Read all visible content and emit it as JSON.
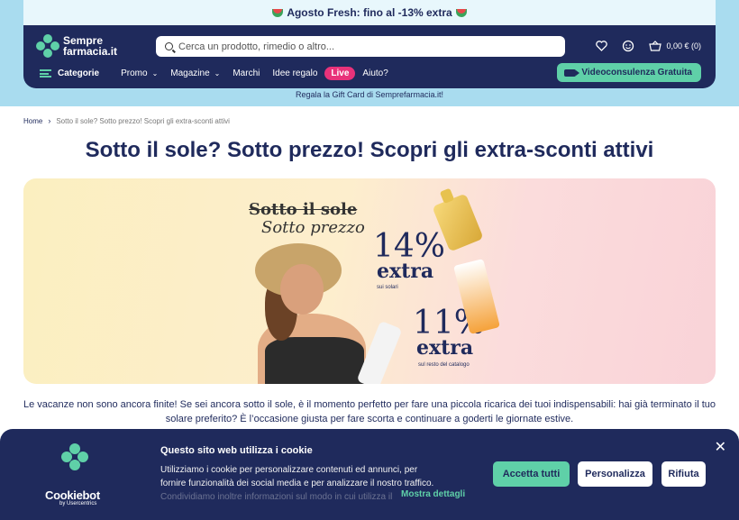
{
  "promo_bar": {
    "text": "Agosto Fresh: fino al -13% extra"
  },
  "header": {
    "logo_line1": "Sempre",
    "logo_line2": "farmacia.it",
    "search_placeholder": "Cerca un prodotto, rimedio o altro...",
    "cart_text": "0,00 € (0)",
    "menu": {
      "categorie": "Categorie",
      "promo": "Promo",
      "magazine": "Magazine",
      "marchi": "Marchi",
      "idee_regalo": "Idee regalo",
      "live": "Live",
      "aiuto": "Aiuto?"
    },
    "video_button": "Videoconsulenza Gratuita"
  },
  "gift_card_text": "Regala la Gift Card di Semprefarmacia.it!",
  "breadcrumb": {
    "home": "Home",
    "current": "Sotto il sole? Sotto prezzo! Scopri gli extra-sconti attivi"
  },
  "page_title": "Sotto il sole? Sotto prezzo! Scopri gli extra-sconti attivi",
  "banner": {
    "headline_strike": "Sotto il sole",
    "headline": "Sotto prezzo",
    "pct1": "14%",
    "extra1": "extra",
    "sub1": "sui solari",
    "pct2": "11%",
    "extra2": "extra",
    "sub2": "sul resto del catalogo"
  },
  "description": "Le vacanze non sono ancora finite! Se sei ancora sotto il sole, è il momento perfetto per fare una piccola ricarica dei tuoi indispensabili: hai già terminato il tuo solare preferito? È l’occasione giusta per fare scorta e continuare a goderti le giornate estive.",
  "cookie": {
    "brand": "Cookiebot",
    "by": "by Usercentrics",
    "title": "Questo sito web utilizza i cookie",
    "text_line1": "Utilizziamo i cookie per personalizzare contenuti ed annunci, per",
    "text_line2": "fornire funzionalità dei social media e per analizzare il nostro traffico.",
    "text_line3": "Condividiamo inoltre informazioni sul modo in cui utilizza il",
    "more": "Mostra dettagli",
    "accept": "Accetta tutti",
    "customize": "Personalizza",
    "refuse": "Rifiuta",
    "close": "✕"
  },
  "colors": {
    "navy": "#1f2a5c",
    "mint": "#5fd0a8",
    "sky": "#a9dcef",
    "live": "#e8327a"
  }
}
